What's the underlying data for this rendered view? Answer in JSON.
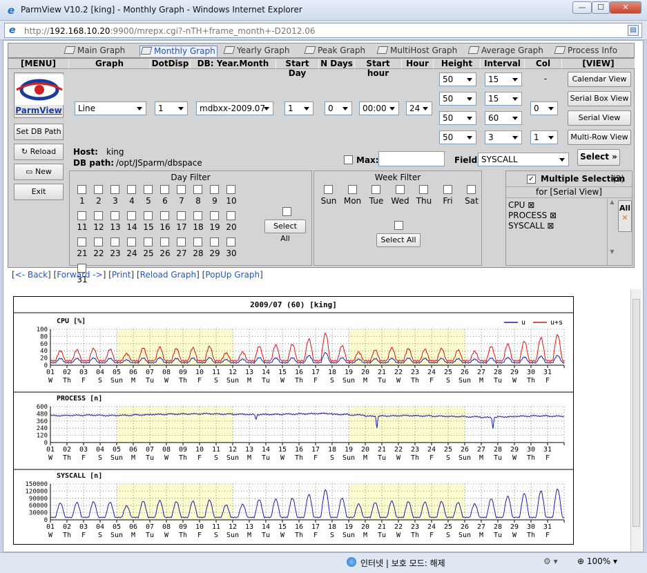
{
  "window": {
    "title": "ParmView V10.2 [king] - Monthly Graph - Windows Internet Explorer",
    "btn_min": "—",
    "btn_max": "☐",
    "btn_close": "✕"
  },
  "address": {
    "url_prefix": "http://",
    "url_host": "192.168.10.20",
    "url_rest": ":9900/mrepx.cgi?-nTH+frame_month+-D2012.06"
  },
  "tabs": [
    "Main Graph",
    "Monthly Graph",
    "Yearly Graph",
    "Peak Graph",
    "MultiHost Graph",
    "Average Graph",
    "Process Info"
  ],
  "active_tab": "Monthly Graph",
  "headers": {
    "menu": "[MENU]",
    "graph": "Graph",
    "dotdisp": "DotDisp",
    "db": "DB: Year.Month",
    "startday": "Start Day",
    "ndays": "N Days",
    "starthour": "Start hour",
    "hour": "Hour",
    "height": "Height",
    "interval": "Interval",
    "col": "Col",
    "view": "[VIEW]"
  },
  "menu": {
    "logo": "ParmView",
    "setdb": "Set DB Path",
    "reload": "Reload",
    "new": "New",
    "exit": "Exit"
  },
  "controls": {
    "graph": "Line",
    "dotdisp": "1",
    "db": "mdbxx-2009.07",
    "startday": "1",
    "ndays": "0",
    "starthour": "00:00",
    "hour": "24",
    "heights": [
      "50",
      "50",
      "50",
      "50"
    ],
    "intervals": [
      "15",
      "15",
      "60",
      "3"
    ],
    "col": [
      "-",
      "0",
      "",
      "1"
    ]
  },
  "view_buttons": [
    "Calendar View",
    "Serial Box View",
    "Serial View",
    "Multi-Row View"
  ],
  "host": {
    "host_label": "Host:",
    "host": "king",
    "path_label": "DB path:",
    "path": "/opt/JSparm/dbspace"
  },
  "max_label": "Max:",
  "field_label": "Field:",
  "field": "SYSCALL",
  "select_btn": "Select",
  "day_filter": {
    "title": "Day Filter",
    "days": [
      "1",
      "2",
      "3",
      "4",
      "5",
      "6",
      "7",
      "8",
      "9",
      "10",
      "11",
      "12",
      "13",
      "14",
      "15",
      "16",
      "17",
      "18",
      "19",
      "20",
      "21",
      "22",
      "23",
      "24",
      "25",
      "26",
      "27",
      "28",
      "29",
      "30",
      "31"
    ],
    "select_all": "Select All"
  },
  "week_filter": {
    "title": "Week Filter",
    "days": [
      "Sun",
      "Mon",
      "Tue",
      "Wed",
      "Thu",
      "Fri",
      "Sat"
    ],
    "select_all": "Select All"
  },
  "multi": {
    "label": "Multiple Selection",
    "count": "(3)",
    "for": "for [Serial View]",
    "items": [
      "CPU",
      "PROCESS",
      "SYSCALL"
    ],
    "all": "All"
  },
  "links": {
    "back": "<- Back",
    "forward": "Forward ->",
    "print": "Print",
    "reload": "Reload Graph",
    "popup": "PopUp Graph"
  },
  "status": {
    "zone": "인터넷 | 보호 모드: 해제",
    "zoom": "100%"
  },
  "chart_data": {
    "type": "line",
    "title": "2009/07 (60) [king]",
    "x_days": [
      "01",
      "02",
      "03",
      "04",
      "05",
      "06",
      "07",
      "08",
      "09",
      "10",
      "11",
      "12",
      "13",
      "14",
      "15",
      "16",
      "17",
      "18",
      "19",
      "20",
      "21",
      "22",
      "23",
      "24",
      "25",
      "26",
      "27",
      "28",
      "29",
      "30",
      "31"
    ],
    "x_weekdays": [
      "W",
      "Th",
      "F",
      "S",
      "Sun",
      "M",
      "Tu",
      "W",
      "Th",
      "F",
      "S",
      "Sun",
      "M",
      "Tu",
      "W",
      "Th",
      "F",
      "S",
      "Sun",
      "M",
      "Tu",
      "W",
      "Th",
      "F",
      "S",
      "Sun",
      "M",
      "Tu",
      "W",
      "Th",
      "F"
    ],
    "highlight_weeks": [
      [
        5,
        11
      ],
      [
        19,
        25
      ]
    ],
    "panels": [
      {
        "name": "CPU [%]",
        "ylim": [
          0,
          100
        ],
        "yticks": [
          "100",
          "80",
          "60",
          "40",
          "20",
          "0"
        ],
        "series": [
          {
            "name": "u",
            "color": "#1a1aaa",
            "base": 10,
            "amp": [
              12,
              12,
              13,
              12,
              8,
              13,
              14,
              12,
              13,
              14,
              9,
              10,
              14,
              13,
              14,
              20,
              28,
              14,
              10,
              11,
              12,
              13,
              12,
              12,
              11,
              10,
              13,
              14,
              16,
              18,
              20
            ]
          },
          {
            "name": "u+s",
            "color": "#dd1111",
            "base": 18,
            "amp": [
              28,
              30,
              34,
              32,
              20,
              36,
              38,
              34,
              36,
              40,
              22,
              24,
              40,
              44,
              46,
              60,
              76,
              42,
              24,
              30,
              36,
              34,
              32,
              34,
              30,
              26,
              40,
              46,
              54,
              64,
              72
            ]
          }
        ]
      },
      {
        "name": "PROCESS [n]",
        "ylim": [
          0,
          600
        ],
        "yticks": [
          "600",
          "480",
          "360",
          "240",
          "120",
          "0"
        ],
        "series": [
          {
            "name": "process",
            "color": "#1a1aaa",
            "level": [
              450,
              455,
              458,
              452,
              455,
              462,
              470,
              475,
              478,
              480,
              475,
              472,
              468,
              470,
              475,
              480,
              485,
              470,
              460,
              440,
              445,
              450,
              445,
              440,
              435,
              430,
              420,
              430,
              440,
              445,
              440
            ],
            "dips": [
              [
                12.4,
                370
              ],
              [
                19.7,
                220
              ],
              [
                26.7,
                210
              ]
            ]
          }
        ]
      },
      {
        "name": "SYSCALL [n]",
        "ylim": [
          0,
          150000
        ],
        "yticks": [
          "150000",
          "120000",
          "90000",
          "60000",
          "30000",
          "0"
        ],
        "series": [
          {
            "name": "syscall",
            "color": "#1a1aaa",
            "base": 15000,
            "amp": [
              60000,
              62000,
              65000,
              63000,
              48000,
              68000,
              70000,
              66000,
              68000,
              72000,
              52000,
              54000,
              74000,
              76000,
              80000,
              95000,
              115000,
              80000,
              56000,
              62000,
              68000,
              66000,
              64000,
              66000,
              62000,
              56000,
              78000,
              88000,
              100000,
              110000,
              118000
            ]
          }
        ]
      }
    ]
  }
}
